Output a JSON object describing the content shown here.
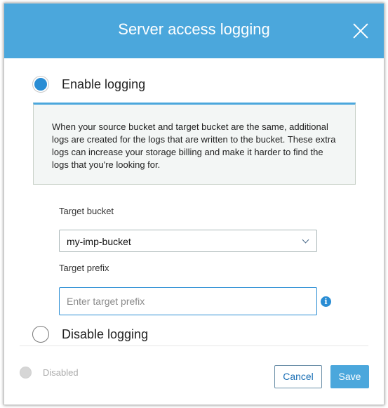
{
  "dialog": {
    "title": "Server access logging",
    "close_icon": "close-icon"
  },
  "options": {
    "enable_label": "Enable logging",
    "enable_checked": true,
    "disable_label": "Disable logging",
    "disable_checked": false
  },
  "info_box": {
    "text": "When your source bucket and target bucket are the same, additional logs are created for the logs that are written to the bucket. These extra logs can increase your storage billing and make it harder to find the logs that you're looking for."
  },
  "target_bucket": {
    "label": "Target bucket",
    "selected": "my-imp-bucket"
  },
  "target_prefix": {
    "label": "Target prefix",
    "value": "",
    "placeholder": "Enter target prefix",
    "help_icon": "info-icon"
  },
  "footer": {
    "status_text": "Disabled",
    "cancel_label": "Cancel",
    "save_label": "Save"
  },
  "colors": {
    "header": "#4ba7dc",
    "accent": "#2a8dd4",
    "info_background": "#f3f6f5"
  }
}
